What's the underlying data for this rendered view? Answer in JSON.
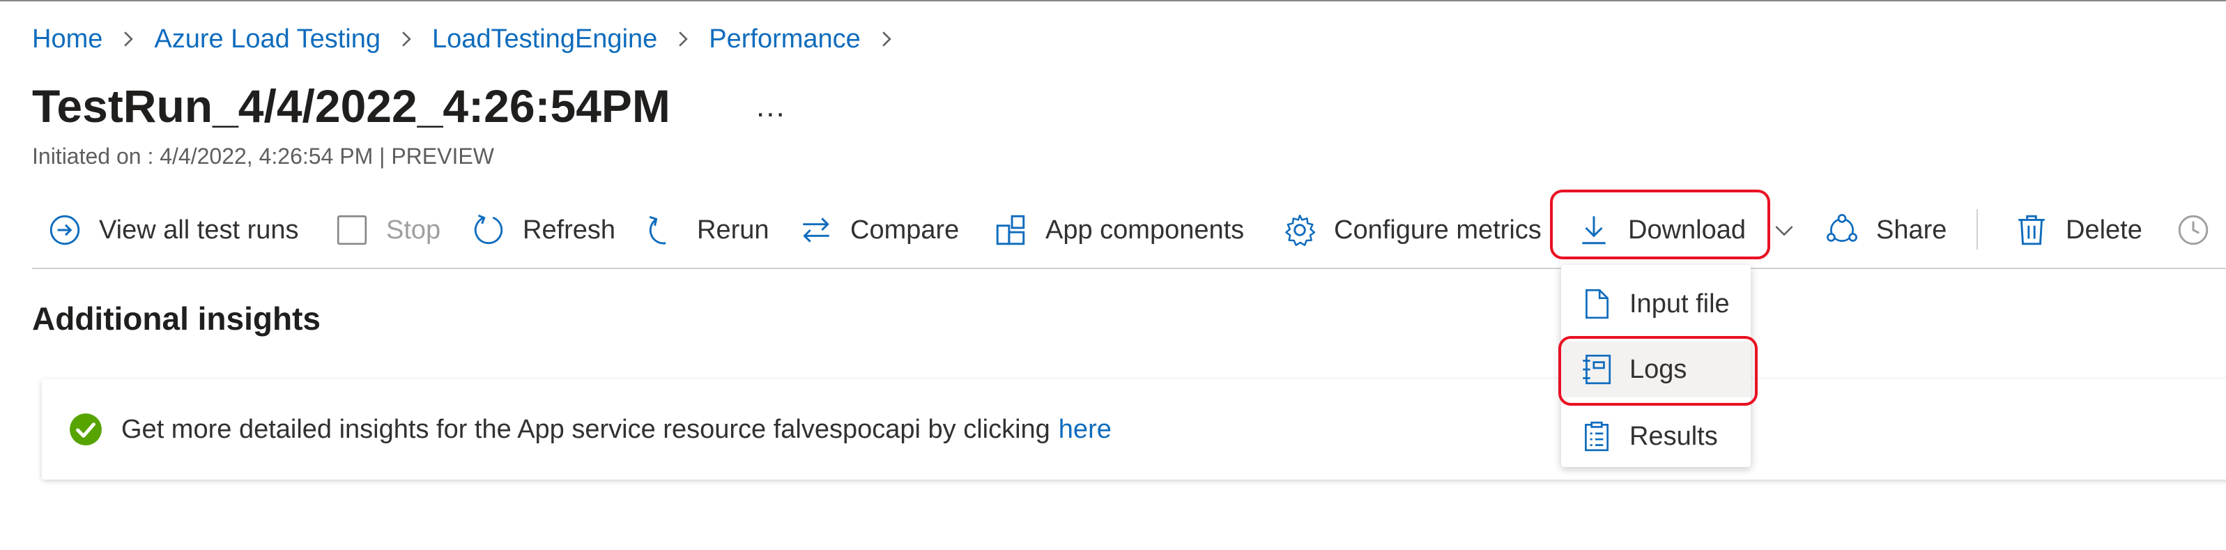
{
  "breadcrumb": [
    "Home",
    "Azure Load Testing",
    "LoadTestingEngine",
    "Performance"
  ],
  "title": "TestRun_4/4/2022_4:26:54PM",
  "more_label": "...",
  "subtitle": "Initiated on : 4/4/2022, 4:26:54 PM | PREVIEW",
  "toolbar": {
    "view_all": "View all test runs",
    "stop": "Stop",
    "refresh": "Refresh",
    "rerun": "Rerun",
    "compare": "Compare",
    "app_components": "App components",
    "configure_metrics": "Configure metrics",
    "download": "Download",
    "share": "Share",
    "delete": "Delete"
  },
  "download_menu": {
    "items": [
      "Input file",
      "Logs",
      "Results"
    ],
    "highlighted": "Logs"
  },
  "section_title": "Additional insights",
  "insight": {
    "message": "Get more detailed insights for the App service resource falvespocapi by clicking",
    "link": "here"
  },
  "colors": {
    "link": "#0f6cbd",
    "highlight": "#e81123",
    "success": "#57a300",
    "text": "#323130"
  }
}
